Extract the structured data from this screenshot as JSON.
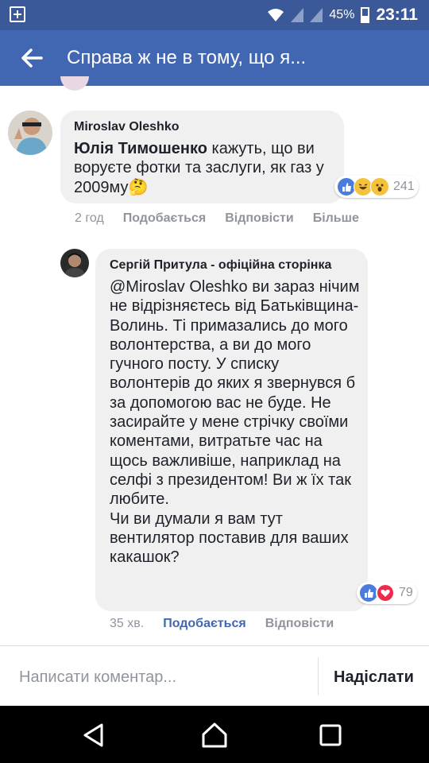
{
  "status_bar": {
    "battery": "45%",
    "time": "23:11"
  },
  "header": {
    "title": "Справа ж не в тому, що я..."
  },
  "comments": [
    {
      "author": "Miroslav Oleshko",
      "mention": "Юлія Тимошенко",
      "text": " кажуть, що ви воруєте фотки та заслуги, як газ у 2009му",
      "emoji": "🤔",
      "reaction_count": "241",
      "time": "2 год",
      "like": "Подобається",
      "reply": "Відповісти",
      "more": "Більше"
    },
    {
      "author": "Сергій Притула - офіційна сторінка",
      "mention": "@Miroslav Oleshko",
      "text": " ви зараз нічим не відрізняєтесь від Батьківщина-Волинь. Ті примазались до мого волонтерства, а ви до мого гучного посту. У списку волонтерів до яких я звернувся б за допомогою вас не буде. Не засирайте у мене стрічку своїми коментами, витратьте час на щось важливіше, наприклад на селфі з президентом! Ви ж їх так любите.",
      "text2": "Чи ви думали я вам тут вентилятор поставив для ваших какашок?",
      "reaction_count": "79",
      "time": "35 хв.",
      "like": "Подобається",
      "reply": "Відповісти"
    }
  ],
  "composer": {
    "placeholder": "Написати коментар...",
    "send": "Надіслати"
  },
  "colors": {
    "status_bar": "#3b5998",
    "header": "#4267b2",
    "bubble": "#f1f0f0",
    "link": "#4267b2",
    "muted": "#90949c"
  }
}
